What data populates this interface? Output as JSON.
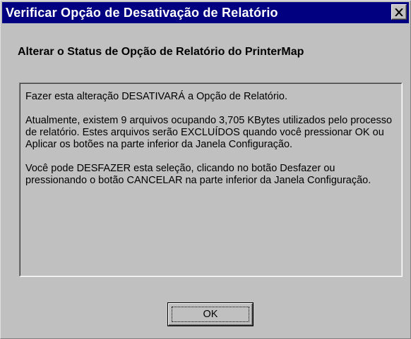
{
  "window": {
    "title": "Verificar Opção de Desativação de Relatório",
    "close_icon": "close-x-icon"
  },
  "dialog": {
    "heading": "Alterar o Status de Opção de Relatório do PrinterMap",
    "paragraphs": [
      "Fazer esta alteração DESATIVARÁ a Opção de Relatório.",
      "Atualmente, existem 9 arquivos ocupando 3,705 KBytes utilizados pelo processo de relatório. Estes arquivos serão EXCLUÍDOS quando você pressionar OK ou Aplicar os botões na parte inferior da Janela Configuração.",
      "Você pode DESFAZER esta seleção, clicando no botão Desfazer ou pressionando o botão CANCELAR na parte inferior da Janela Configuração."
    ]
  },
  "buttons": {
    "ok_label": "OK"
  },
  "colors": {
    "titlebar": "#000080",
    "face": "#c0c0c0"
  }
}
